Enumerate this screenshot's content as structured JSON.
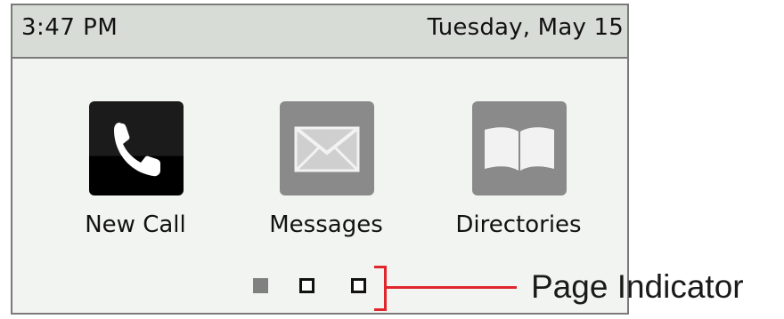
{
  "status_bar": {
    "time": "3:47 PM",
    "date": "Tuesday, May 15"
  },
  "apps": [
    {
      "label": "New Call",
      "icon": "phone-handset-icon"
    },
    {
      "label": "Messages",
      "icon": "envelope-icon"
    },
    {
      "label": "Directories",
      "icon": "open-book-icon"
    }
  ],
  "page_indicator": {
    "current_page": 1,
    "total_pages": 3
  },
  "annotation": {
    "label": "Page Indicator",
    "color": "#e0262c"
  }
}
